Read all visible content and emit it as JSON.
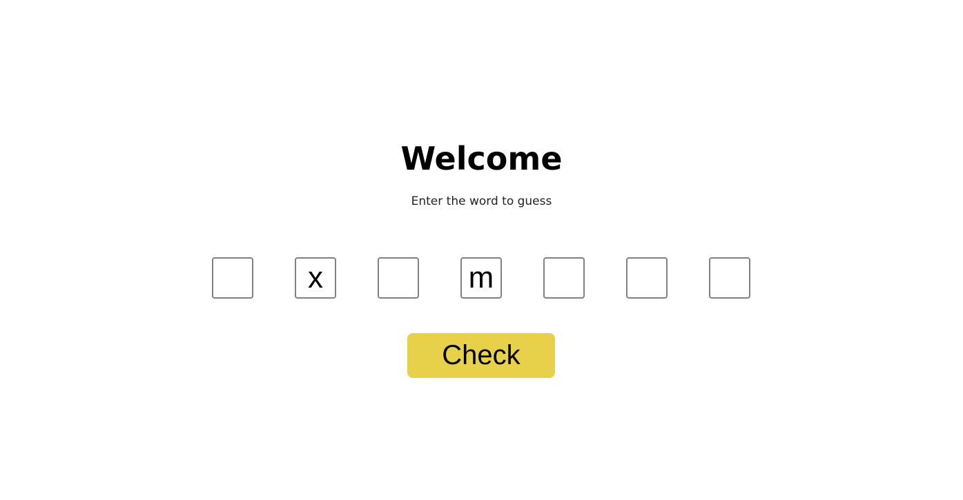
{
  "header": {
    "title": "Welcome",
    "subtitle": "Enter the word to guess"
  },
  "word_inputs": {
    "letters": [
      "",
      "x",
      "",
      "m",
      "",
      "",
      ""
    ]
  },
  "actions": {
    "check_label": "Check"
  },
  "colors": {
    "check_button_bg": "#e8d14a",
    "input_border": "#808080"
  }
}
